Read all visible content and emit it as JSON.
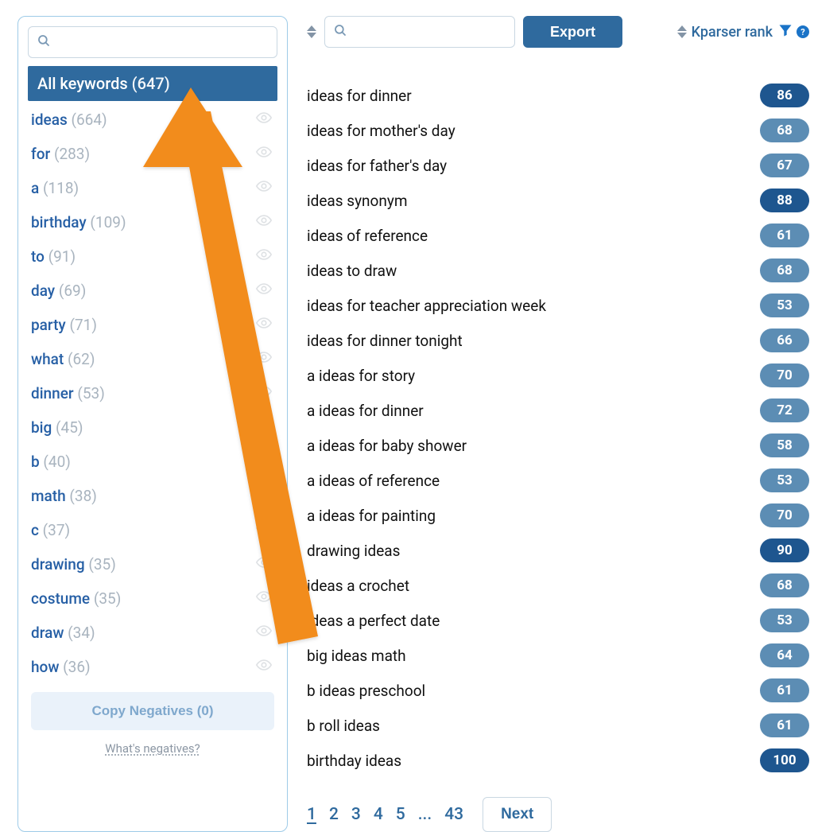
{
  "sidebar": {
    "search_placeholder": "",
    "all_keywords_label": "All keywords",
    "all_keywords_count": "(647)",
    "items": [
      {
        "word": "ideas",
        "count": "(664)"
      },
      {
        "word": "for",
        "count": "(283)"
      },
      {
        "word": "a",
        "count": "(118)"
      },
      {
        "word": "birthday",
        "count": "(109)"
      },
      {
        "word": "to",
        "count": "(91)"
      },
      {
        "word": "day",
        "count": "(69)"
      },
      {
        "word": "party",
        "count": "(71)"
      },
      {
        "word": "what",
        "count": "(62)"
      },
      {
        "word": "dinner",
        "count": "(53)"
      },
      {
        "word": "big",
        "count": "(45)"
      },
      {
        "word": "b",
        "count": "(40)"
      },
      {
        "word": "math",
        "count": "(38)"
      },
      {
        "word": "c",
        "count": "(37)"
      },
      {
        "word": "drawing",
        "count": "(35)"
      },
      {
        "word": "costume",
        "count": "(35)"
      },
      {
        "word": "draw",
        "count": "(34)"
      },
      {
        "word": "how",
        "count": "(36)"
      }
    ],
    "copy_negatives_label": "Copy Negatives (0)",
    "whats_negatives_label": "What's negatives?"
  },
  "toolbar": {
    "export_label": "Export",
    "rank_label": "Kparser rank"
  },
  "results": [
    {
      "phrase": "ideas for dinner",
      "score": 86,
      "tone": "dark"
    },
    {
      "phrase": "ideas for mother's day",
      "score": 68,
      "tone": "mid"
    },
    {
      "phrase": "ideas for father's day",
      "score": 67,
      "tone": "mid"
    },
    {
      "phrase": "ideas synonym",
      "score": 88,
      "tone": "dark"
    },
    {
      "phrase": "ideas of reference",
      "score": 61,
      "tone": "mid"
    },
    {
      "phrase": "ideas to draw",
      "score": 68,
      "tone": "mid"
    },
    {
      "phrase": "ideas for teacher appreciation week",
      "score": 53,
      "tone": "mid"
    },
    {
      "phrase": "ideas for dinner tonight",
      "score": 66,
      "tone": "mid"
    },
    {
      "phrase": "a ideas for story",
      "score": 70,
      "tone": "mid"
    },
    {
      "phrase": "a ideas for dinner",
      "score": 72,
      "tone": "mid"
    },
    {
      "phrase": "a ideas for baby shower",
      "score": 58,
      "tone": "mid"
    },
    {
      "phrase": "a ideas of reference",
      "score": 53,
      "tone": "mid"
    },
    {
      "phrase": "a ideas for painting",
      "score": 70,
      "tone": "mid"
    },
    {
      "phrase": "drawing ideas",
      "score": 90,
      "tone": "dark"
    },
    {
      "phrase": "ideas a crochet",
      "score": 68,
      "tone": "mid"
    },
    {
      "phrase": "ideas a perfect date",
      "score": 53,
      "tone": "mid"
    },
    {
      "phrase": "big ideas math",
      "score": 64,
      "tone": "mid"
    },
    {
      "phrase": "b ideas preschool",
      "score": 61,
      "tone": "mid"
    },
    {
      "phrase": "b roll ideas",
      "score": 61,
      "tone": "mid"
    },
    {
      "phrase": "birthday ideas",
      "score": 100,
      "tone": "dark"
    }
  ],
  "pagination": {
    "pages": [
      "1",
      "2",
      "3",
      "4",
      "5",
      "...",
      "43"
    ],
    "active_index": 0,
    "next_label": "Next"
  }
}
